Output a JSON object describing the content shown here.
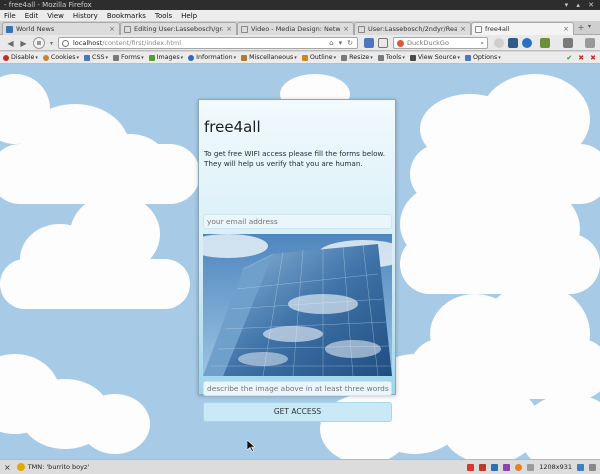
{
  "window": {
    "title": "- free4all - Mozilla Firefox",
    "controls": "▾ ▴ ✕"
  },
  "menu": [
    "File",
    "Edit",
    "View",
    "History",
    "Bookmarks",
    "Tools",
    "Help"
  ],
  "tabs": [
    {
      "label": "World News",
      "active": false,
      "favicon_color": "#3b6fb6"
    },
    {
      "label": "Editing User:Lassebosch/gra...",
      "active": false,
      "favicon_color": "#777777"
    },
    {
      "label": "Video - Media Design: Networ...",
      "active": false,
      "favicon_color": "#777777"
    },
    {
      "label": "User:Lassebosch/2ndyr/Read...",
      "active": false,
      "favicon_color": "#777777"
    },
    {
      "label": "free4all",
      "active": true,
      "favicon_color": "#ffffff"
    }
  ],
  "new_tab": "+",
  "nav": {
    "back": "◀",
    "forward": "▶",
    "url_host": "localhost",
    "url_path": "/content/first/index.html",
    "search_placeholder": "DuckDuckGo"
  },
  "devbar": [
    {
      "label": "Disable",
      "icon": "disable-icon",
      "color": "#cc2a2a"
    },
    {
      "label": "Cookies",
      "icon": "cookie-icon",
      "color": "#c7862e"
    },
    {
      "label": "CSS",
      "icon": "css-icon",
      "color": "#4a76c4"
    },
    {
      "label": "Forms",
      "icon": "forms-icon",
      "color": "#7a7a7a"
    },
    {
      "label": "Images",
      "icon": "images-icon",
      "color": "#5a9c3d"
    },
    {
      "label": "Information",
      "icon": "info-icon",
      "color": "#2f6db8"
    },
    {
      "label": "Miscellaneous",
      "icon": "misc-icon",
      "color": "#b07b2a"
    },
    {
      "label": "Outline",
      "icon": "outline-icon",
      "color": "#c48a2b"
    },
    {
      "label": "Resize",
      "icon": "resize-icon",
      "color": "#7a7a7a"
    },
    {
      "label": "Tools",
      "icon": "tools-icon",
      "color": "#7a7a7a"
    },
    {
      "label": "View Source",
      "icon": "view-source-icon",
      "color": "#4a4a4a"
    },
    {
      "label": "Options",
      "icon": "options-icon",
      "color": "#4a76c4"
    }
  ],
  "page": {
    "title": "free4all",
    "intro": "To get free WIFI access please fill the forms below. They will help us verify that you are human.",
    "email_placeholder": "your email address",
    "describe_placeholder": "describe the image above in at least three words",
    "button": "GET ACCESS"
  },
  "status": {
    "text": "TMN: 'burrito boyz'",
    "resolution": "1208x931"
  }
}
